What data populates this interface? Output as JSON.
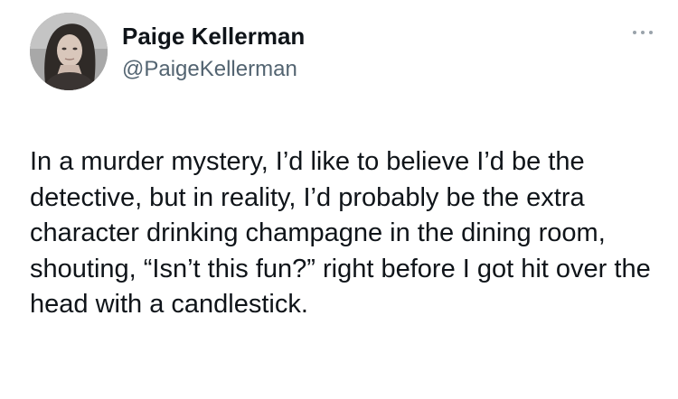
{
  "tweet": {
    "author": {
      "display_name": "Paige Kellerman",
      "handle": "@PaigeKellerman",
      "avatar_icon": "profile-photo"
    },
    "more_icon": "more-options-icon",
    "text": "In a murder mystery, I’d like to believe I’d be the detective, but in reality, I’d probably be the extra character drinking champagne in the dining room, shouting, “Isn’t this fun?” right before I got hit over the head with a candlestick."
  }
}
